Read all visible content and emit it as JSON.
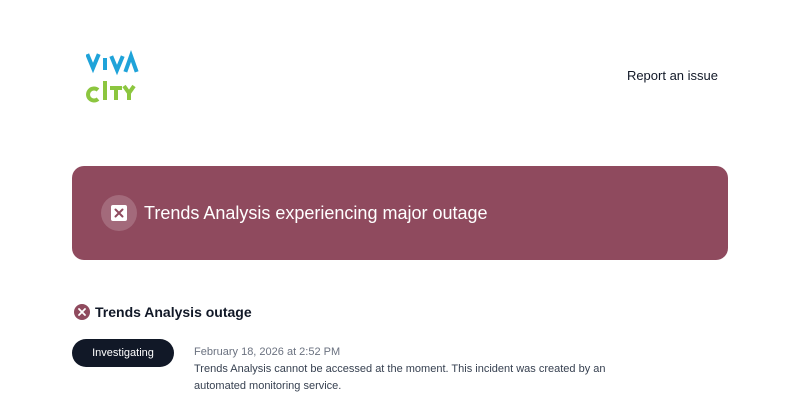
{
  "header": {
    "logo_text": "VIVA CITY",
    "report_link": "Report an issue"
  },
  "banner": {
    "title": "Trends Analysis experiencing major outage",
    "icon": "close-square-icon",
    "color": "#8f4a5e"
  },
  "incident": {
    "title": "Trends Analysis outage",
    "icon": "error-circle-icon",
    "status": "Investigating",
    "update_time": "February 18, 2026 at 2:52 PM",
    "update_text": "Trends Analysis cannot be accessed at the moment. This incident was created by an automated monitoring service."
  },
  "colors": {
    "outage": "#8f4a5e",
    "pill": "#111827",
    "logo_blue": "#1fa3d9",
    "logo_green": "#8cc63f"
  }
}
